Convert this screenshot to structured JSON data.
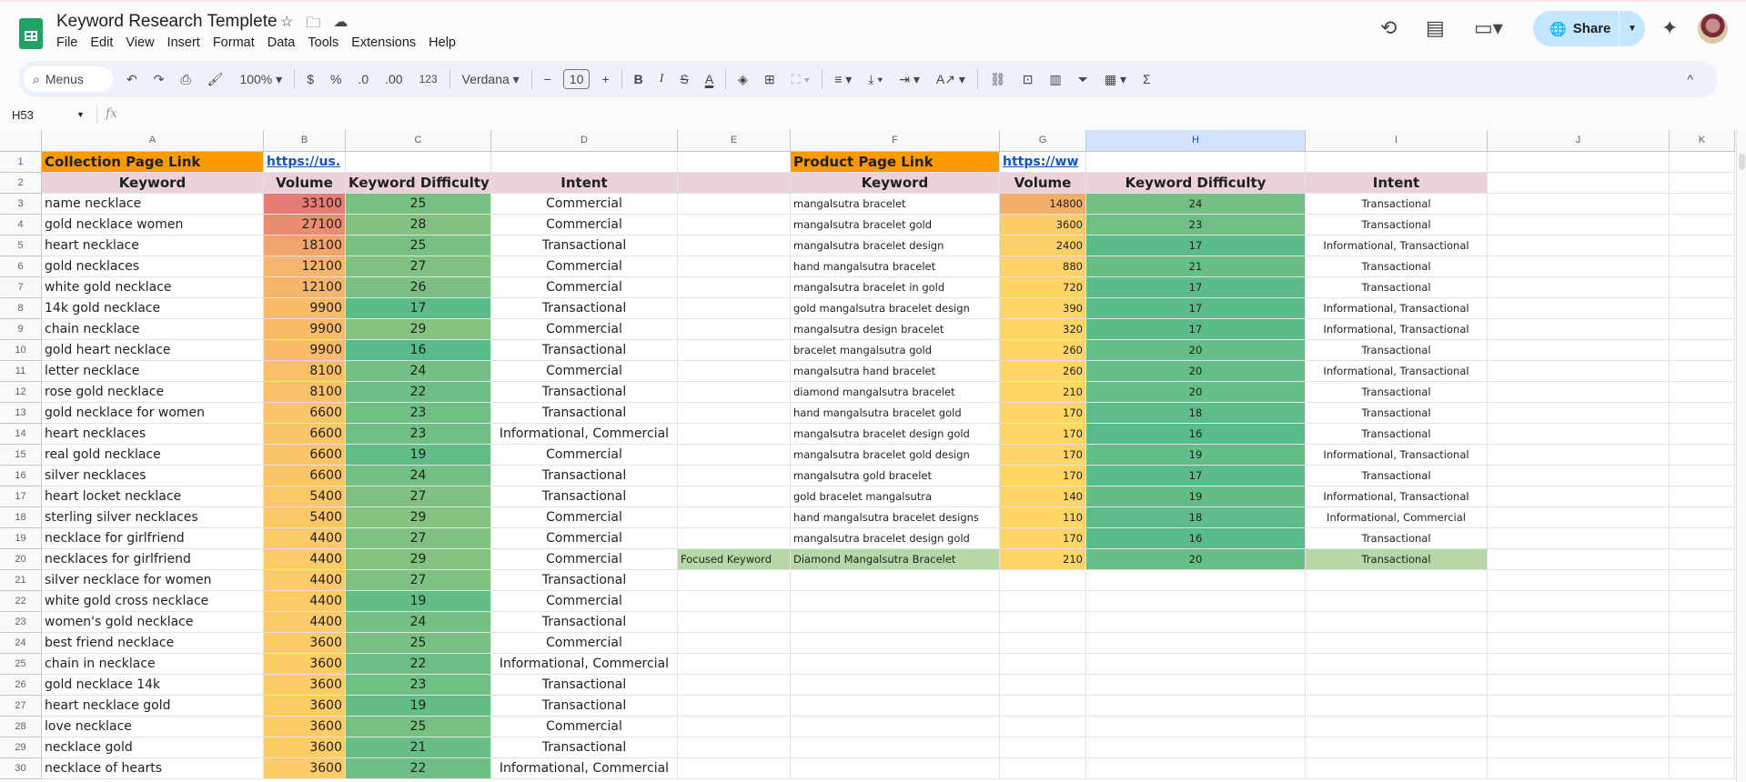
{
  "app": {
    "title": "Keyword Research Templete",
    "menu": [
      "File",
      "Edit",
      "View",
      "Insert",
      "Format",
      "Data",
      "Tools",
      "Extensions",
      "Help"
    ],
    "share_label": "Share"
  },
  "toolbar": {
    "search_label": "Menus",
    "zoom": "100%",
    "currency": "$",
    "percent": "%",
    "dec_decrease": ".0",
    "dec_increase": ".00",
    "format_123": "123",
    "font": "Verdana",
    "font_size": "10"
  },
  "formula_bar": {
    "name_box": "H53",
    "fx": "fx"
  },
  "columns": [
    "A",
    "B",
    "C",
    "D",
    "E",
    "F",
    "G",
    "H",
    "I",
    "J",
    "K"
  ],
  "colors": {
    "orange": "#ff9900",
    "header_pink": "#ead1dc",
    "focus_green": "#b6d7a8",
    "vol_low": "#ffd666",
    "vol_high": "#e67c73",
    "kd_low": "#57bb8a",
    "kd_high": "#86c27f",
    "link": "#1155cc",
    "selected_col": "#d3e3fd"
  },
  "collection": {
    "label": "Collection Page Link",
    "link": "https://us.",
    "headers": [
      "Keyword",
      "Volume",
      "Keyword Difficulty",
      "Intent"
    ],
    "rows": [
      [
        "name necklace",
        33100,
        25,
        "Commercial"
      ],
      [
        "gold necklace women",
        27100,
        28,
        "Commercial"
      ],
      [
        "heart necklace",
        18100,
        25,
        "Transactional"
      ],
      [
        "gold necklaces",
        12100,
        27,
        "Commercial"
      ],
      [
        "white gold necklace",
        12100,
        26,
        "Commercial"
      ],
      [
        "14k gold necklace",
        9900,
        17,
        "Transactional"
      ],
      [
        "chain necklace",
        9900,
        29,
        "Commercial"
      ],
      [
        "gold heart necklace",
        9900,
        16,
        "Transactional"
      ],
      [
        "letter necklace",
        8100,
        24,
        "Commercial"
      ],
      [
        "rose gold necklace",
        8100,
        22,
        "Transactional"
      ],
      [
        "gold necklace for women",
        6600,
        23,
        "Transactional"
      ],
      [
        "heart necklaces",
        6600,
        23,
        "Informational, Commercial"
      ],
      [
        "real gold necklace",
        6600,
        19,
        "Commercial"
      ],
      [
        "silver necklaces",
        6600,
        24,
        "Transactional"
      ],
      [
        "heart locket necklace",
        5400,
        27,
        "Transactional"
      ],
      [
        "sterling silver necklaces",
        5400,
        29,
        "Commercial"
      ],
      [
        "necklace for girlfriend",
        4400,
        27,
        "Commercial"
      ],
      [
        "necklaces for girlfriend",
        4400,
        29,
        "Commercial"
      ],
      [
        "silver necklace for women",
        4400,
        27,
        "Transactional"
      ],
      [
        "white gold cross necklace",
        4400,
        19,
        "Commercial"
      ],
      [
        "women's gold necklace",
        4400,
        24,
        "Transactional"
      ],
      [
        "best friend necklace",
        3600,
        25,
        "Commercial"
      ],
      [
        "chain in necklace",
        3600,
        22,
        "Informational, Commercial"
      ],
      [
        "gold necklace 14k",
        3600,
        23,
        "Transactional"
      ],
      [
        "heart necklace gold",
        3600,
        19,
        "Transactional"
      ],
      [
        "love necklace",
        3600,
        25,
        "Commercial"
      ],
      [
        "necklace gold",
        3600,
        21,
        "Transactional"
      ],
      [
        "necklace of hearts",
        3600,
        22,
        "Informational, Commercial"
      ]
    ]
  },
  "product": {
    "label": "Product Page Link",
    "link": "https://ww",
    "headers": [
      "Keyword",
      "Volume",
      "Keyword Difficulty",
      "Intent"
    ],
    "rows": [
      [
        "mangalsutra bracelet",
        14800,
        24,
        "Transactional"
      ],
      [
        "mangalsutra bracelet gold",
        3600,
        23,
        "Transactional"
      ],
      [
        "mangalsutra bracelet design",
        2400,
        17,
        "Informational, Transactional"
      ],
      [
        "hand mangalsutra bracelet",
        880,
        21,
        "Transactional"
      ],
      [
        "mangalsutra bracelet in gold",
        720,
        17,
        "Transactional"
      ],
      [
        "gold mangalsutra bracelet design",
        390,
        17,
        "Informational, Transactional"
      ],
      [
        "mangalsutra design bracelet",
        320,
        17,
        "Informational, Transactional"
      ],
      [
        "bracelet mangalsutra gold",
        260,
        20,
        "Transactional"
      ],
      [
        "mangalsutra hand bracelet",
        260,
        20,
        "Informational, Transactional"
      ],
      [
        "diamond mangalsutra bracelet",
        210,
        20,
        "Transactional"
      ],
      [
        "hand mangalsutra bracelet gold",
        170,
        18,
        "Transactional"
      ],
      [
        "mangalsutra bracelet design gold",
        170,
        16,
        "Transactional"
      ],
      [
        "mangalsutra bracelet gold design",
        170,
        19,
        "Informational, Transactional"
      ],
      [
        "mangalsutra gold bracelet",
        170,
        17,
        "Transactional"
      ],
      [
        "gold bracelet mangalsutra",
        140,
        19,
        "Informational, Transactional"
      ],
      [
        "hand mangalsutra bracelet designs",
        110,
        18,
        "Informational, Commercial"
      ],
      [
        "mangalsutra bracelet design gold",
        170,
        16,
        "Transactional"
      ]
    ],
    "focused": {
      "label": "Focused Keyword",
      "keyword": "Diamond Mangalsutra Bracelet",
      "volume": 210,
      "kd": 20,
      "intent": "Transactional"
    }
  }
}
